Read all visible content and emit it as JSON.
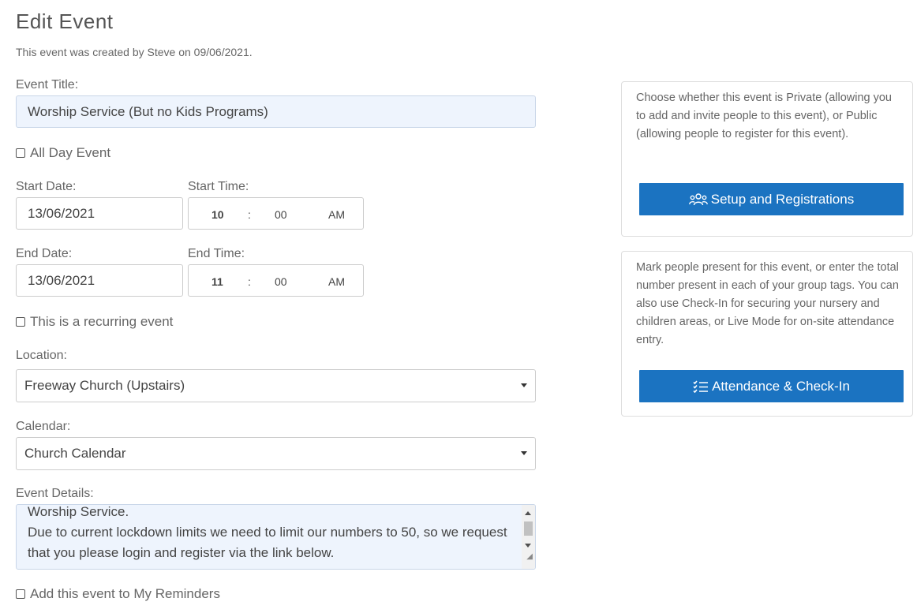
{
  "page": {
    "title": "Edit Event",
    "created_note": "This event was created by Steve on 09/06/2021."
  },
  "form": {
    "event_title_label": "Event Title:",
    "event_title_value": "Worship Service (But no Kids Programs)",
    "all_day_label": "All Day Event",
    "start_date_label": "Start Date:",
    "start_date_value": "13/06/2021",
    "start_time_label": "Start Time:",
    "start_time": {
      "hour": "10",
      "sep": ":",
      "minute": "00",
      "ampm": "AM"
    },
    "end_date_label": "End Date:",
    "end_date_value": "13/06/2021",
    "end_time_label": "End Time:",
    "end_time": {
      "hour": "11",
      "sep": ":",
      "minute": "00",
      "ampm": "AM"
    },
    "recurring_label": "This is a recurring event",
    "location_label": "Location:",
    "location_value": "Freeway Church (Upstairs)",
    "calendar_label": "Calendar:",
    "calendar_value": "Church Calendar",
    "details_label": "Event Details:",
    "details_value": "Worship Service.\nDue to current lockdown limits we need to limit our numbers to 50, so we request that you please login and register via the link below.",
    "reminders_label": "Add this event to My Reminders"
  },
  "panels": {
    "setup": {
      "text": "Choose whether this event is Private (allowing you to add and invite people to this event), or Public (allowing people to register for this event).",
      "button": "Setup and Registrations",
      "icon": "people-group-icon"
    },
    "attendance": {
      "text": "Mark people present for this event, or enter the total number present in each of your group tags. You can also use Check-In for securing your nursery and children areas, or Live Mode for on-site attendance entry.",
      "button": "Attendance & Check-In",
      "icon": "checklist-icon"
    }
  },
  "colors": {
    "accent": "#1b73c1",
    "filled_input_bg": "#eef4fd"
  }
}
